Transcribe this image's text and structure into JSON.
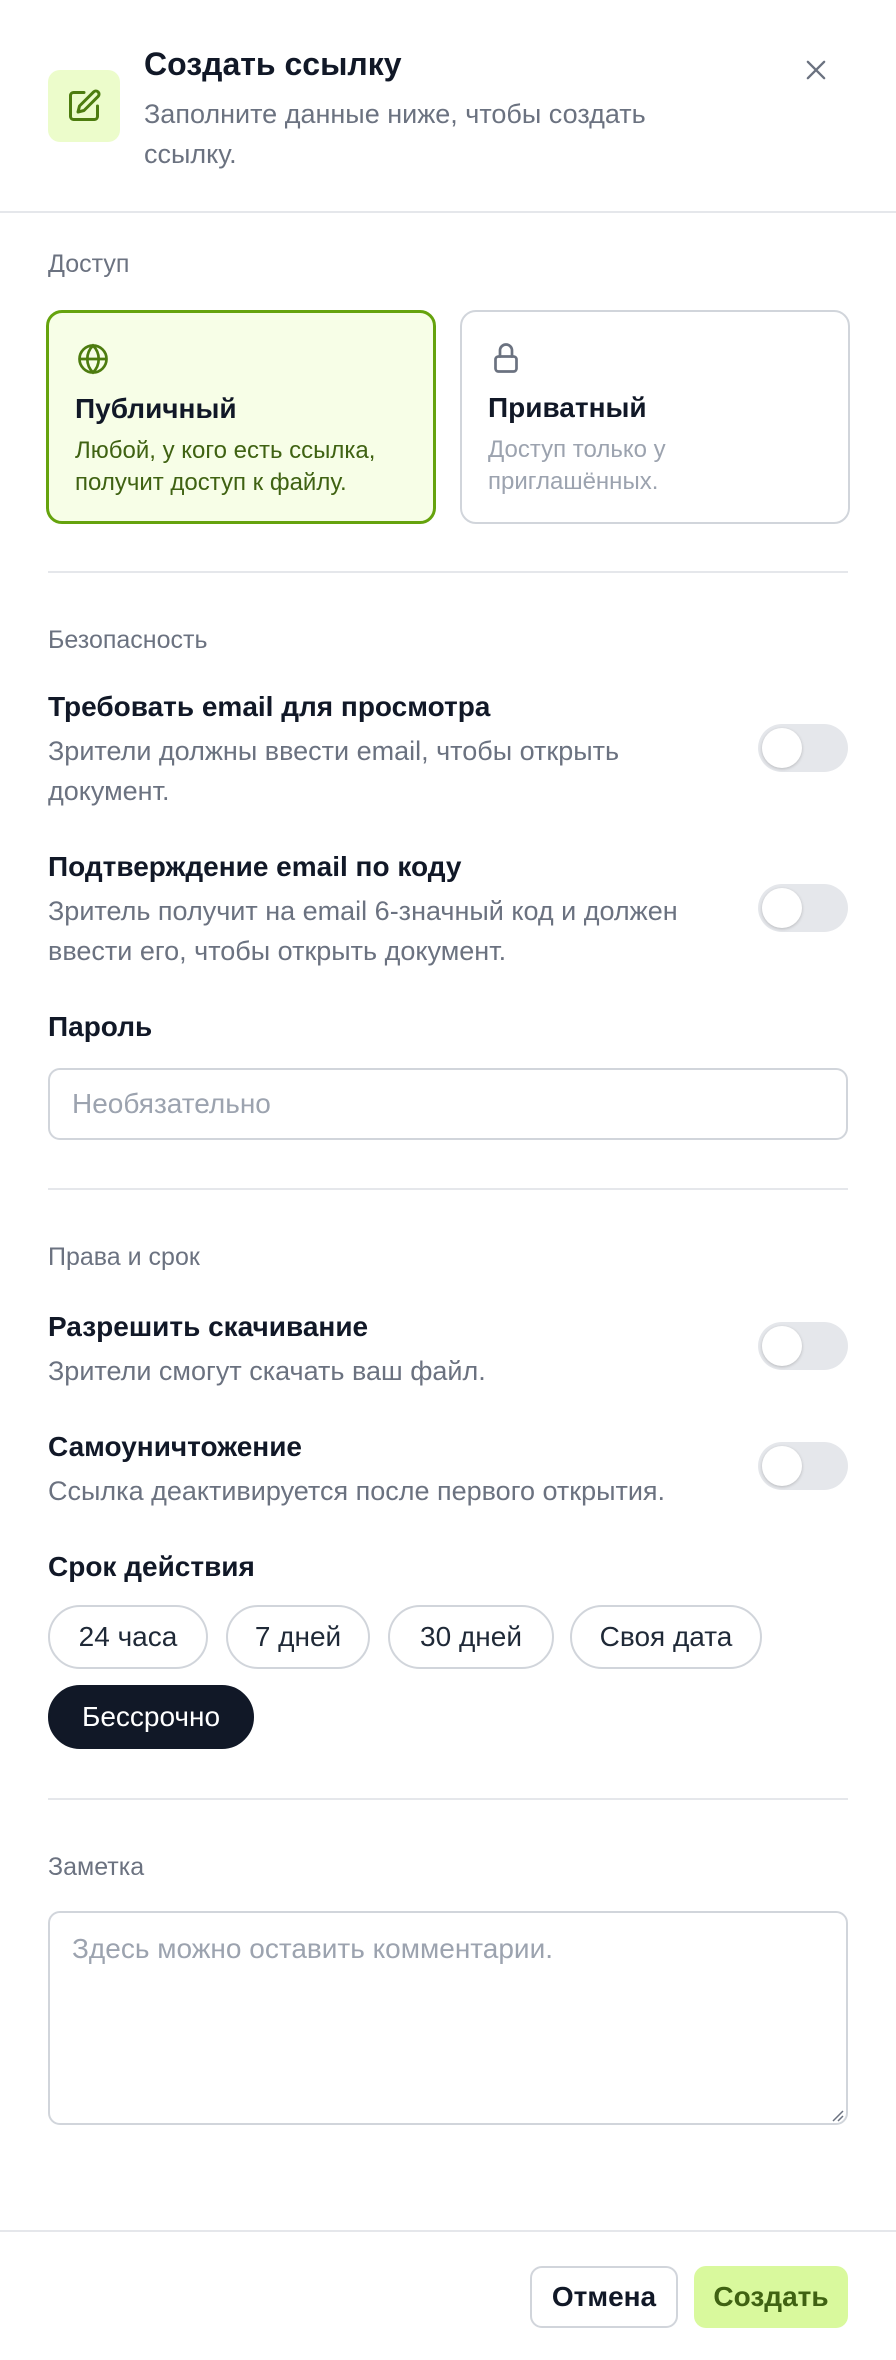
{
  "header": {
    "title": "Создать ссылку",
    "subtitle": "Заполните данные ниже, чтобы создать ссылку."
  },
  "access": {
    "label": "Доступ",
    "options": [
      {
        "title": "Публичный",
        "desc": "Любой, у кого есть ссылка, получит доступ к файлу.",
        "icon": "globe-icon",
        "selected": true
      },
      {
        "title": "Приватный",
        "desc": "Доступ только у приглашённых.",
        "icon": "lock-icon",
        "selected": false
      }
    ]
  },
  "security": {
    "label": "Безопасность",
    "require_email": {
      "title": "Требовать email для просмотра",
      "desc": "Зрители должны ввести email, чтобы открыть документ.",
      "enabled": false
    },
    "email_code": {
      "title": "Подтверждение email по коду",
      "desc": "Зритель получит на email 6-значный код и должен ввести его, чтобы открыть документ.",
      "enabled": false
    },
    "password": {
      "label": "Пароль",
      "placeholder": "Необязательно",
      "value": ""
    }
  },
  "rights": {
    "label": "Права и срок",
    "allow_download": {
      "title": "Разрешить скачивание",
      "desc": "Зрители смогут скачать ваш файл.",
      "enabled": false
    },
    "self_destruct": {
      "title": "Самоуничтожение",
      "desc": "Ссылка деактивируется после первого открытия.",
      "enabled": false
    },
    "expiry": {
      "label": "Срок действия",
      "options": [
        "24 часа",
        "7 дней",
        "30 дней",
        "Своя дата",
        "Бессрочно"
      ],
      "selected": "Бессрочно"
    }
  },
  "note": {
    "label": "Заметка",
    "placeholder": "Здесь можно оставить комментарии.",
    "value": ""
  },
  "footer": {
    "cancel_label": "Отмена",
    "create_label": "Создать"
  },
  "colors": {
    "accent": "#65a30d",
    "accent_bg": "#f7fee7",
    "create_bg": "#d9f99d",
    "active_chip": "#111827"
  }
}
